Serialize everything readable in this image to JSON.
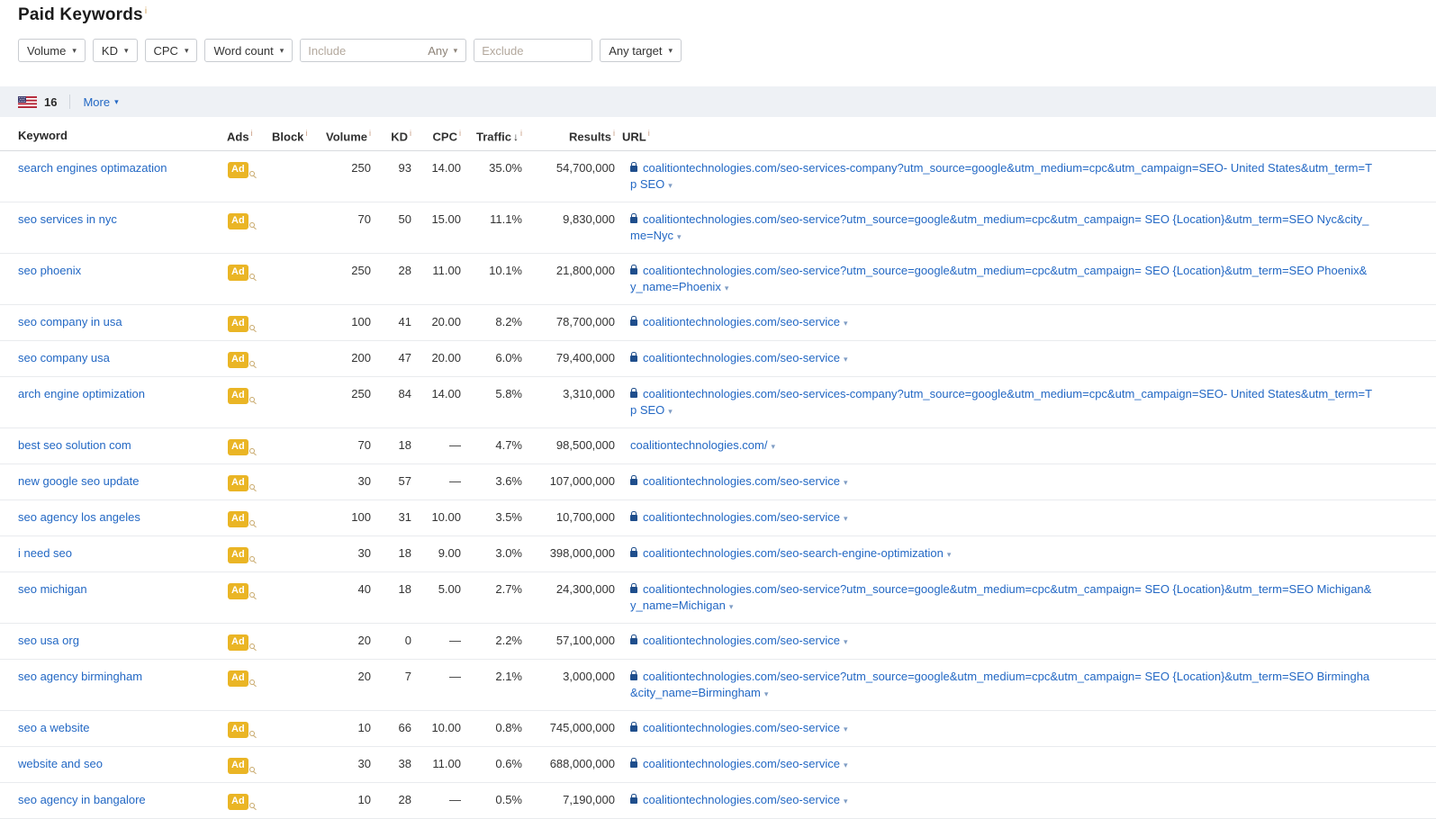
{
  "page": {
    "title": "Paid Keywords",
    "info_mark": "i"
  },
  "filters": {
    "volume_label": "Volume",
    "kd_label": "KD",
    "cpc_label": "CPC",
    "word_count_label": "Word count",
    "include_placeholder": "Include",
    "include_match_label": "Any",
    "exclude_placeholder": "Exclude",
    "target_label": "Any target",
    "caret": "▾"
  },
  "countries_bar": {
    "flag_icon": "us-flag",
    "count": "16",
    "more_label": "More",
    "caret": "▾"
  },
  "table": {
    "ads_label": "Ad",
    "info_mark": "i",
    "url_caret": "▾",
    "headers": {
      "keyword": "Keyword",
      "ads": "Ads",
      "block": "Block",
      "volume": "Volume",
      "kd": "KD",
      "cpc": "CPC",
      "traffic": "Traffic",
      "sort_arrow": "↓",
      "results": "Results",
      "url": "URL"
    },
    "rows": [
      {
        "keyword": "search engines optimazation",
        "volume": "250",
        "kd": "93",
        "cpc": "14.00",
        "traffic": "35.0%",
        "results": "54,700,000",
        "lock": true,
        "url_line1": "coalitiontechnologies.com/seo-services-company?utm_source=google&utm_medium=cpc&utm_campaign=SEO- United States&utm_term=T",
        "url_line2": "p SEO"
      },
      {
        "keyword": "seo services in nyc",
        "volume": "70",
        "kd": "50",
        "cpc": "15.00",
        "traffic": "11.1%",
        "results": "9,830,000",
        "lock": true,
        "url_line1": "coalitiontechnologies.com/seo-service?utm_source=google&utm_medium=cpc&utm_campaign= SEO {Location}&utm_term=SEO Nyc&city_",
        "url_line2": "me=Nyc"
      },
      {
        "keyword": "seo phoenix",
        "volume": "250",
        "kd": "28",
        "cpc": "11.00",
        "traffic": "10.1%",
        "results": "21,800,000",
        "lock": true,
        "url_line1": "coalitiontechnologies.com/seo-service?utm_source=google&utm_medium=cpc&utm_campaign= SEO {Location}&utm_term=SEO Phoenix&",
        "url_line2": "y_name=Phoenix"
      },
      {
        "keyword": "seo company in usa",
        "volume": "100",
        "kd": "41",
        "cpc": "20.00",
        "traffic": "8.2%",
        "results": "78,700,000",
        "lock": true,
        "url_line1": "coalitiontechnologies.com/seo-service",
        "url_line2": null
      },
      {
        "keyword": "seo company usa",
        "volume": "200",
        "kd": "47",
        "cpc": "20.00",
        "traffic": "6.0%",
        "results": "79,400,000",
        "lock": true,
        "url_line1": "coalitiontechnologies.com/seo-service",
        "url_line2": null
      },
      {
        "keyword": "arch engine optimization",
        "volume": "250",
        "kd": "84",
        "cpc": "14.00",
        "traffic": "5.8%",
        "results": "3,310,000",
        "lock": true,
        "url_line1": "coalitiontechnologies.com/seo-services-company?utm_source=google&utm_medium=cpc&utm_campaign=SEO- United States&utm_term=T",
        "url_line2": "p SEO"
      },
      {
        "keyword": "best seo solution com",
        "volume": "70",
        "kd": "18",
        "cpc": "—",
        "traffic": "4.7%",
        "results": "98,500,000",
        "lock": false,
        "url_line1": "coalitiontechnologies.com/",
        "url_line2": null
      },
      {
        "keyword": "new google seo update",
        "volume": "30",
        "kd": "57",
        "cpc": "—",
        "traffic": "3.6%",
        "results": "107,000,000",
        "lock": true,
        "url_line1": "coalitiontechnologies.com/seo-service",
        "url_line2": null
      },
      {
        "keyword": "seo agency los angeles",
        "volume": "100",
        "kd": "31",
        "cpc": "10.00",
        "traffic": "3.5%",
        "results": "10,700,000",
        "lock": true,
        "url_line1": "coalitiontechnologies.com/seo-service",
        "url_line2": null
      },
      {
        "keyword": "i need seo",
        "volume": "30",
        "kd": "18",
        "cpc": "9.00",
        "traffic": "3.0%",
        "results": "398,000,000",
        "lock": true,
        "url_line1": "coalitiontechnologies.com/seo-search-engine-optimization",
        "url_line2": null
      },
      {
        "keyword": "seo michigan",
        "volume": "40",
        "kd": "18",
        "cpc": "5.00",
        "traffic": "2.7%",
        "results": "24,300,000",
        "lock": true,
        "url_line1": "coalitiontechnologies.com/seo-service?utm_source=google&utm_medium=cpc&utm_campaign= SEO {Location}&utm_term=SEO Michigan&",
        "url_line2": "y_name=Michigan"
      },
      {
        "keyword": "seo usa org",
        "volume": "20",
        "kd": "0",
        "cpc": "—",
        "traffic": "2.2%",
        "results": "57,100,000",
        "lock": true,
        "url_line1": "coalitiontechnologies.com/seo-service",
        "url_line2": null
      },
      {
        "keyword": "seo agency birmingham",
        "volume": "20",
        "kd": "7",
        "cpc": "—",
        "traffic": "2.1%",
        "results": "3,000,000",
        "lock": true,
        "url_line1": "coalitiontechnologies.com/seo-service?utm_source=google&utm_medium=cpc&utm_campaign= SEO {Location}&utm_term=SEO Birmingha",
        "url_line2": "&city_name=Birmingham"
      },
      {
        "keyword": "seo a website",
        "volume": "10",
        "kd": "66",
        "cpc": "10.00",
        "traffic": "0.8%",
        "results": "745,000,000",
        "lock": true,
        "url_line1": "coalitiontechnologies.com/seo-service",
        "url_line2": null
      },
      {
        "keyword": "website and seo",
        "volume": "30",
        "kd": "38",
        "cpc": "11.00",
        "traffic": "0.6%",
        "results": "688,000,000",
        "lock": true,
        "url_line1": "coalitiontechnologies.com/seo-service",
        "url_line2": null
      },
      {
        "keyword": "seo agency in bangalore",
        "volume": "10",
        "kd": "28",
        "cpc": "—",
        "traffic": "0.5%",
        "results": "7,190,000",
        "lock": true,
        "url_line1": "coalitiontechnologies.com/seo-service",
        "url_line2": null
      }
    ]
  },
  "colors": {
    "link_blue": "#2368c4",
    "ad_badge_yellow": "#eab525",
    "band_background": "#eef1f5",
    "info_mark_tan": "#c89a80"
  }
}
